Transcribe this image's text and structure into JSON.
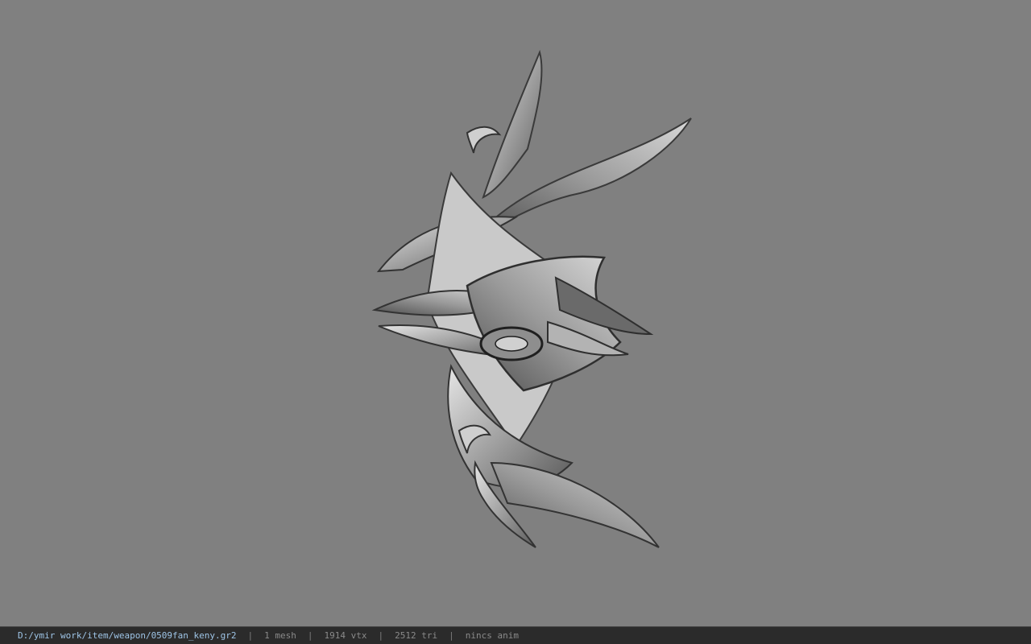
{
  "viewer": {
    "background_color": "#808080",
    "model_icon": "spiked-fan-weapon-model"
  },
  "status_bar": {
    "file_path": "D:/ymir work/item/weapon/0509fan_keny.gr2",
    "separator": "|",
    "mesh_count": "1 mesh",
    "vertex_count": "1914 vtx",
    "triangle_count": "2512 tri",
    "animation_status": "nincs anim"
  }
}
